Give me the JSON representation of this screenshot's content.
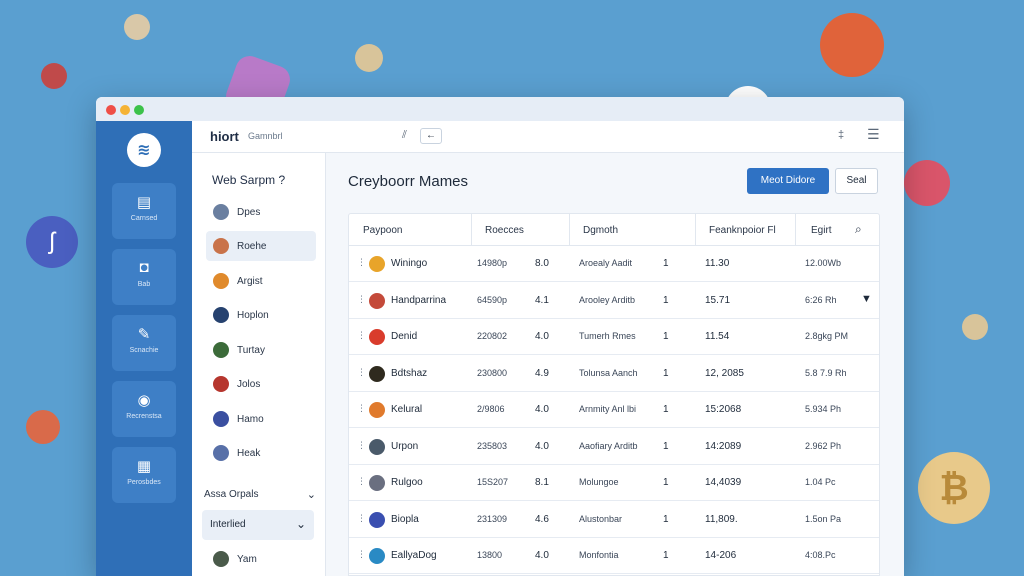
{
  "window": {
    "brand": "hiort",
    "brand_sub": "Gamnbrl"
  },
  "topbar": {
    "back_label": "←",
    "menu_icon": "menu-icon",
    "pin_icon": "pin-icon"
  },
  "rail": {
    "items": [
      {
        "label": "Carnsed",
        "icon": "wallet-icon"
      },
      {
        "label": "Bab",
        "icon": "bag-icon"
      },
      {
        "label": "Scnachie",
        "icon": "edit-icon"
      },
      {
        "label": "Recrenstsa",
        "icon": "coin-icon"
      },
      {
        "label": "Perosbdes",
        "icon": "chart-icon"
      }
    ]
  },
  "sidebar": {
    "heading": "Web Sarpm ?",
    "items": [
      {
        "label": "Dpes",
        "color": "#6a7fa0"
      },
      {
        "label": "Roehe",
        "color": "#c9734a"
      },
      {
        "label": "Argist",
        "color": "#e08a2c"
      },
      {
        "label": "Hoplon",
        "color": "#26426f"
      },
      {
        "label": "Turtay",
        "color": "#3c6b3a"
      },
      {
        "label": "Jolos",
        "color": "#b6362e"
      },
      {
        "label": "Hamo",
        "color": "#3a4fa0"
      },
      {
        "label": "Heak",
        "color": "#5870a8"
      }
    ],
    "assets_heading": "Assa Orpals",
    "selected": "Interlied",
    "bottom_item": "Yam"
  },
  "main": {
    "title": "Creyboorr Mames",
    "primary_button": "Meot Didore",
    "secondary_button": "Seal"
  },
  "table": {
    "headers": [
      "Paypoon",
      "Roecces",
      "Dgmoth",
      "Feanknpoior Fl",
      "Egirt"
    ],
    "rows": [
      {
        "name": "Winingo",
        "code": "14980p",
        "score": "8.0",
        "desc": "Aroealy Aadit",
        "n": "1",
        "val": "11.30",
        "time": "12.00Wb",
        "color": "#e8a42a"
      },
      {
        "name": "Handparrina",
        "code": "64590p",
        "score": "4.1",
        "desc": "Arooley Arditb",
        "n": "1",
        "val": "15.71",
        "time": "6:26 Rh",
        "color": "#c44a3a"
      },
      {
        "name": "Denid",
        "code": "220802",
        "score": "4.0",
        "desc": "Tumerh Rmes",
        "n": "1",
        "val": "11.54",
        "time": "2.8gkg PM",
        "color": "#d93c2c"
      },
      {
        "name": "Bdtshaz",
        "code": "230800",
        "score": "4.9",
        "desc": "Tolunsa Aanch",
        "n": "1",
        "val": "12, 2085",
        "time": "5.8 7.9 Rh",
        "color": "#2f2a1e"
      },
      {
        "name": "Kelural",
        "code": "2/9806",
        "score": "4.0",
        "desc": "Arnmity Anl lbi",
        "n": "1",
        "val": "15:2068",
        "time": "5.934 Ph",
        "color": "#e07a2c"
      },
      {
        "name": "Urpon",
        "code": "235803",
        "score": "4.0",
        "desc": "Aaofiary Arditb",
        "n": "1",
        "val": "14:2089",
        "time": "2.962 Ph",
        "color": "#4a5a6a"
      },
      {
        "name": "Rulgoo",
        "code": "15S207",
        "score": "8.1",
        "desc": "Molungoe",
        "n": "1",
        "val": "14,4039",
        "time": "1.04 Pc",
        "color": "#6a6f80"
      },
      {
        "name": "Biopla",
        "code": "231309",
        "score": "4.6",
        "desc": "Alustonbar",
        "n": "1",
        "val": "11,809.",
        "time": "1.5on Pa",
        "color": "#3a4fb0"
      },
      {
        "name": "EallyaDog",
        "code": "13800",
        "score": "4.0",
        "desc": "Monfontia",
        "n": "1",
        "val": "14-206",
        "time": "4:08.Pc",
        "color": "#2a8ac4"
      }
    ]
  },
  "colors": {
    "rail": "#2f6fb7",
    "accent": "#2f72c4",
    "background": "#5a9fd0"
  }
}
